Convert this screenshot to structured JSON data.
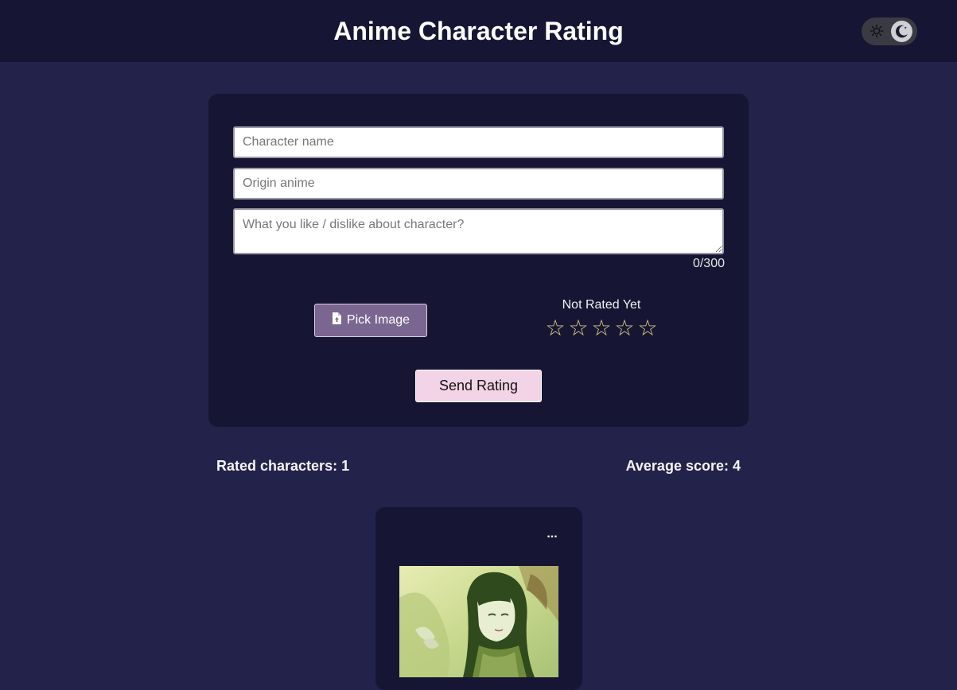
{
  "header": {
    "title": "Anime Character Rating",
    "theme_toggle": {
      "mode": "dark",
      "icons": [
        "sun-icon",
        "moon-icon"
      ]
    }
  },
  "form": {
    "name_placeholder": "Character name",
    "origin_placeholder": "Origin anime",
    "comment_placeholder": "What you like / dislike about character?",
    "char_counter": "0/300",
    "pick_image_label": "Pick Image",
    "pick_image_icon": "file-upload-icon",
    "rating_status": "Not Rated Yet",
    "stars": [
      "☆",
      "☆",
      "☆",
      "☆",
      "☆"
    ],
    "send_label": "Send Rating"
  },
  "stats": {
    "rated_characters": "Rated characters: 1",
    "average_score": "Average score: 4"
  },
  "character_card": {
    "menu_label": "...",
    "image_alt": "character-image"
  },
  "colors": {
    "background": "#22224a",
    "card": "#161634",
    "accent_button": "#7a6690",
    "send_button": "#f2d4e6",
    "star": "#e6cf8a"
  }
}
